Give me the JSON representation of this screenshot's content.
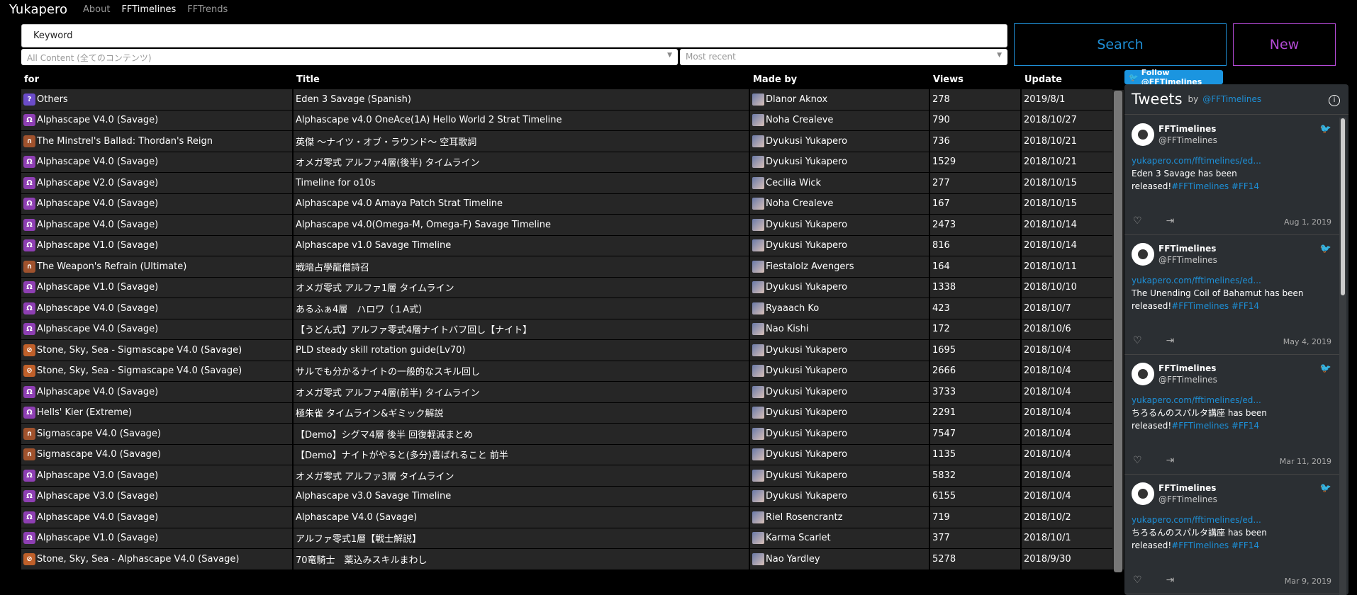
{
  "navbar": {
    "brand": "Yukapero",
    "links": [
      "About",
      "FFTimelines",
      "FFTrends"
    ]
  },
  "search": {
    "keyword_placeholder": "Keyword",
    "content_select": "All Content (全てのコンテンツ)",
    "sort_select": "Most recent",
    "search_label": "Search",
    "new_label": "New"
  },
  "colors": {
    "search_accent": "#1f8fd6",
    "new_accent": "#b44ad6",
    "twitter_blue": "#1b95e0"
  },
  "table": {
    "headers": {
      "for": "for",
      "title": "Title",
      "made_by": "Made by",
      "views": "Views",
      "update": "Update"
    },
    "rows": [
      {
        "icon": "question-icon",
        "for": "Others",
        "title": "Eden 3 Savage (Spanish)",
        "made_by": "Dlanor Aknox",
        "views": "278",
        "update": "2019/8/1"
      },
      {
        "icon": "alphascape-icon",
        "for": "Alphascape V4.0 (Savage)",
        "title": "Alphascape v4.0 OneAce(1A) Hello World 2 Strat Timeline",
        "made_by": "Noha Crealeve",
        "views": "790",
        "update": "2018/10/27"
      },
      {
        "icon": "trial-icon",
        "for": "The Minstrel's Ballad: Thordan's Reign",
        "title": "英傑 ～ナイツ・オブ・ラウンド～ 空耳歌詞",
        "made_by": "Dyukusi Yukapero",
        "views": "736",
        "update": "2018/10/21"
      },
      {
        "icon": "alphascape-icon",
        "for": "Alphascape V4.0 (Savage)",
        "title": "オメガ零式 アルファ4層(後半) タイムライン",
        "made_by": "Dyukusi Yukapero",
        "views": "1529",
        "update": "2018/10/21"
      },
      {
        "icon": "alphascape-icon",
        "for": "Alphascape V2.0 (Savage)",
        "title": "Timeline for o10s",
        "made_by": "Cecilia Wick",
        "views": "277",
        "update": "2018/10/15"
      },
      {
        "icon": "alphascape-icon",
        "for": "Alphascape V4.0 (Savage)",
        "title": "Alphascape v4.0 Amaya Patch Strat Timeline",
        "made_by": "Noha Crealeve",
        "views": "167",
        "update": "2018/10/15"
      },
      {
        "icon": "alphascape-icon",
        "for": "Alphascape V4.0 (Savage)",
        "title": "Alphascape v4.0(Omega-M, Omega-F) Savage Timeline",
        "made_by": "Dyukusi Yukapero",
        "views": "2473",
        "update": "2018/10/14"
      },
      {
        "icon": "alphascape-icon",
        "for": "Alphascape V1.0 (Savage)",
        "title": "Alphascape v1.0 Savage Timeline",
        "made_by": "Dyukusi Yukapero",
        "views": "816",
        "update": "2018/10/14"
      },
      {
        "icon": "trial-icon",
        "for": "The Weapon's Refrain (Ultimate)",
        "title": "戦暗占學龍僧詩召",
        "made_by": "Fiestalolz Avengers",
        "views": "164",
        "update": "2018/10/11"
      },
      {
        "icon": "alphascape-icon",
        "for": "Alphascape V1.0 (Savage)",
        "title": "オメガ零式 アルファ1層 タイムライン",
        "made_by": "Dyukusi Yukapero",
        "views": "1338",
        "update": "2018/10/10"
      },
      {
        "icon": "alphascape-icon",
        "for": "Alphascape V4.0 (Savage)",
        "title": "あるふぁ4層　ハロワ（１A式）",
        "made_by": "Ryaaach Ko",
        "views": "423",
        "update": "2018/10/7"
      },
      {
        "icon": "alphascape-icon",
        "for": "Alphascape V4.0 (Savage)",
        "title": "【うどん式】アルファ零式4層ナイトバフ回し【ナイト】",
        "made_by": "Nao Kishi",
        "views": "172",
        "update": "2018/10/6"
      },
      {
        "icon": "guide-icon",
        "for": "Stone, Sky, Sea - Sigmascape V4.0 (Savage)",
        "title": "PLD steady skill rotation guide(Lv70)",
        "made_by": "Dyukusi Yukapero",
        "views": "1695",
        "update": "2018/10/4"
      },
      {
        "icon": "guide-icon",
        "for": "Stone, Sky, Sea - Sigmascape V4.0 (Savage)",
        "title": "サルでも分かるナイトの一般的なスキル回し",
        "made_by": "Dyukusi Yukapero",
        "views": "2666",
        "update": "2018/10/4"
      },
      {
        "icon": "alphascape-icon",
        "for": "Alphascape V4.0 (Savage)",
        "title": "オメガ零式 アルファ4層(前半) タイムライン",
        "made_by": "Dyukusi Yukapero",
        "views": "3733",
        "update": "2018/10/4"
      },
      {
        "icon": "alphascape-icon",
        "for": "Hells' Kier (Extreme)",
        "title": "極朱雀 タイムライン&ギミック解説",
        "made_by": "Dyukusi Yukapero",
        "views": "2291",
        "update": "2018/10/4"
      },
      {
        "icon": "trial-icon",
        "for": "Sigmascape V4.0 (Savage)",
        "title": "【Demo】シグマ4層 後半 回復軽減まとめ",
        "made_by": "Dyukusi Yukapero",
        "views": "7547",
        "update": "2018/10/4"
      },
      {
        "icon": "trial-icon",
        "for": "Sigmascape V4.0 (Savage)",
        "title": "【Demo】ナイトがやると(多分)喜ばれること 前半",
        "made_by": "Dyukusi Yukapero",
        "views": "1135",
        "update": "2018/10/4"
      },
      {
        "icon": "alphascape-icon",
        "for": "Alphascape V3.0 (Savage)",
        "title": "オメガ零式 アルファ3層 タイムライン",
        "made_by": "Dyukusi Yukapero",
        "views": "5832",
        "update": "2018/10/4"
      },
      {
        "icon": "alphascape-icon",
        "for": "Alphascape V3.0 (Savage)",
        "title": "Alphascape v3.0 Savage Timeline",
        "made_by": "Dyukusi Yukapero",
        "views": "6155",
        "update": "2018/10/4"
      },
      {
        "icon": "alphascape-icon",
        "for": "Alphascape V4.0 (Savage)",
        "title": "Alphascape V4.0 (Savage)",
        "made_by": "Riel Rosencrantz",
        "views": "719",
        "update": "2018/10/2"
      },
      {
        "icon": "alphascape-icon",
        "for": "Alphascape V1.0 (Savage)",
        "title": "アルファ零式1層【戦士解説】",
        "made_by": "Karma Scarlet",
        "views": "377",
        "update": "2018/10/1"
      },
      {
        "icon": "guide-icon",
        "for": "Stone, Sky, Sea - Alphascape V4.0 (Savage)",
        "title": "70竜騎士　薬込みスキルまわし",
        "made_by": "Nao Yardley",
        "views": "5278",
        "update": "2018/9/30"
      }
    ]
  },
  "twitter": {
    "follow_label": "Follow @FFTimelines",
    "header_title": "Tweets",
    "header_by": "by",
    "header_handle": "@FFTimelines",
    "tweets": [
      {
        "name": "FFTimelines",
        "user": "@FFTimelines",
        "link": "yukapero.com/fftimelines/ed...",
        "text": "Eden 3 Savage has been released!",
        "tags": "#FFTimelines #FF14",
        "date": "Aug 1, 2019"
      },
      {
        "name": "FFTimelines",
        "user": "@FFTimelines",
        "link": "yukapero.com/fftimelines/ed...",
        "text": "The Unending Coil of Bahamut has been released!",
        "tags": "#FFTimelines #FF14",
        "date": "May 4, 2019"
      },
      {
        "name": "FFTimelines",
        "user": "@FFTimelines",
        "link": "yukapero.com/fftimelines/ed...",
        "text": "ちろるんのスパルタ講座 has been released!",
        "tags": "#FFTimelines #FF14",
        "date": "Mar 11, 2019"
      },
      {
        "name": "FFTimelines",
        "user": "@FFTimelines",
        "link": "yukapero.com/fftimelines/ed...",
        "text": "ちろるんのスパルタ講座 has been released!",
        "tags": "#FFTimelines #FF14",
        "date": "Mar 9, 2019"
      }
    ]
  }
}
